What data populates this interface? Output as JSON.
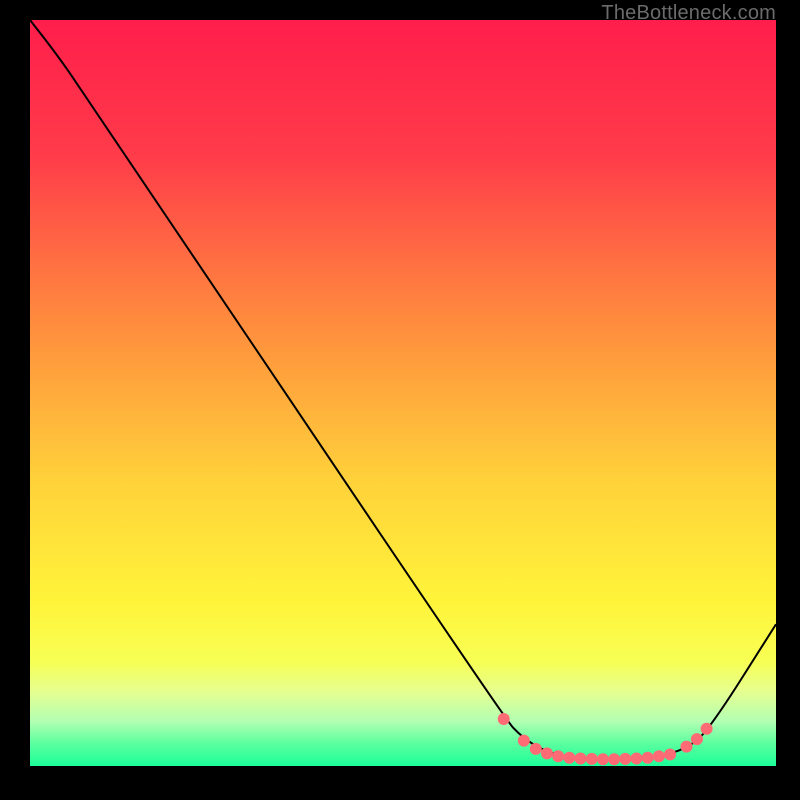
{
  "watermark": "TheBottleneck.com",
  "chart_data": {
    "type": "line",
    "title": "",
    "xlabel": "",
    "ylabel": "",
    "xlim": [
      0,
      100
    ],
    "ylim": [
      0,
      100
    ],
    "gradient_stops": [
      {
        "offset": 0,
        "color": "#ff1e4b"
      },
      {
        "offset": 18,
        "color": "#ff3b4a"
      },
      {
        "offset": 40,
        "color": "#ff8a3e"
      },
      {
        "offset": 62,
        "color": "#ffd23a"
      },
      {
        "offset": 78,
        "color": "#fff43a"
      },
      {
        "offset": 86,
        "color": "#f7ff54"
      },
      {
        "offset": 90,
        "color": "#e6ff90"
      },
      {
        "offset": 94,
        "color": "#b3ffb3"
      },
      {
        "offset": 97,
        "color": "#5bff9e"
      },
      {
        "offset": 100,
        "color": "#1bff9a"
      }
    ],
    "series": [
      {
        "name": "curve",
        "points": [
          {
            "x": 0.0,
            "y": 100.0
          },
          {
            "x": 3.5,
            "y": 95.5
          },
          {
            "x": 7.0,
            "y": 90.5
          },
          {
            "x": 63.5,
            "y": 6.5
          },
          {
            "x": 66.0,
            "y": 3.8
          },
          {
            "x": 69.0,
            "y": 2.0
          },
          {
            "x": 72.0,
            "y": 1.2
          },
          {
            "x": 76.0,
            "y": 0.9
          },
          {
            "x": 80.0,
            "y": 0.9
          },
          {
            "x": 84.0,
            "y": 1.2
          },
          {
            "x": 88.0,
            "y": 2.3
          },
          {
            "x": 91.0,
            "y": 4.8
          },
          {
            "x": 100.0,
            "y": 19.0
          }
        ]
      }
    ],
    "markers": [
      {
        "x": 63.5,
        "y": 6.3
      },
      {
        "x": 66.2,
        "y": 3.4
      },
      {
        "x": 67.8,
        "y": 2.3
      },
      {
        "x": 69.3,
        "y": 1.7
      },
      {
        "x": 70.8,
        "y": 1.3
      },
      {
        "x": 72.3,
        "y": 1.1
      },
      {
        "x": 73.8,
        "y": 1.0
      },
      {
        "x": 75.3,
        "y": 0.95
      },
      {
        "x": 76.8,
        "y": 0.9
      },
      {
        "x": 78.3,
        "y": 0.9
      },
      {
        "x": 79.8,
        "y": 0.95
      },
      {
        "x": 81.3,
        "y": 1.0
      },
      {
        "x": 82.8,
        "y": 1.1
      },
      {
        "x": 84.3,
        "y": 1.3
      },
      {
        "x": 85.8,
        "y": 1.55
      },
      {
        "x": 88.0,
        "y": 2.6
      },
      {
        "x": 89.4,
        "y": 3.6
      },
      {
        "x": 90.7,
        "y": 5.0
      }
    ],
    "marker_color": "#ff6b74",
    "curve_color": "#000000"
  }
}
